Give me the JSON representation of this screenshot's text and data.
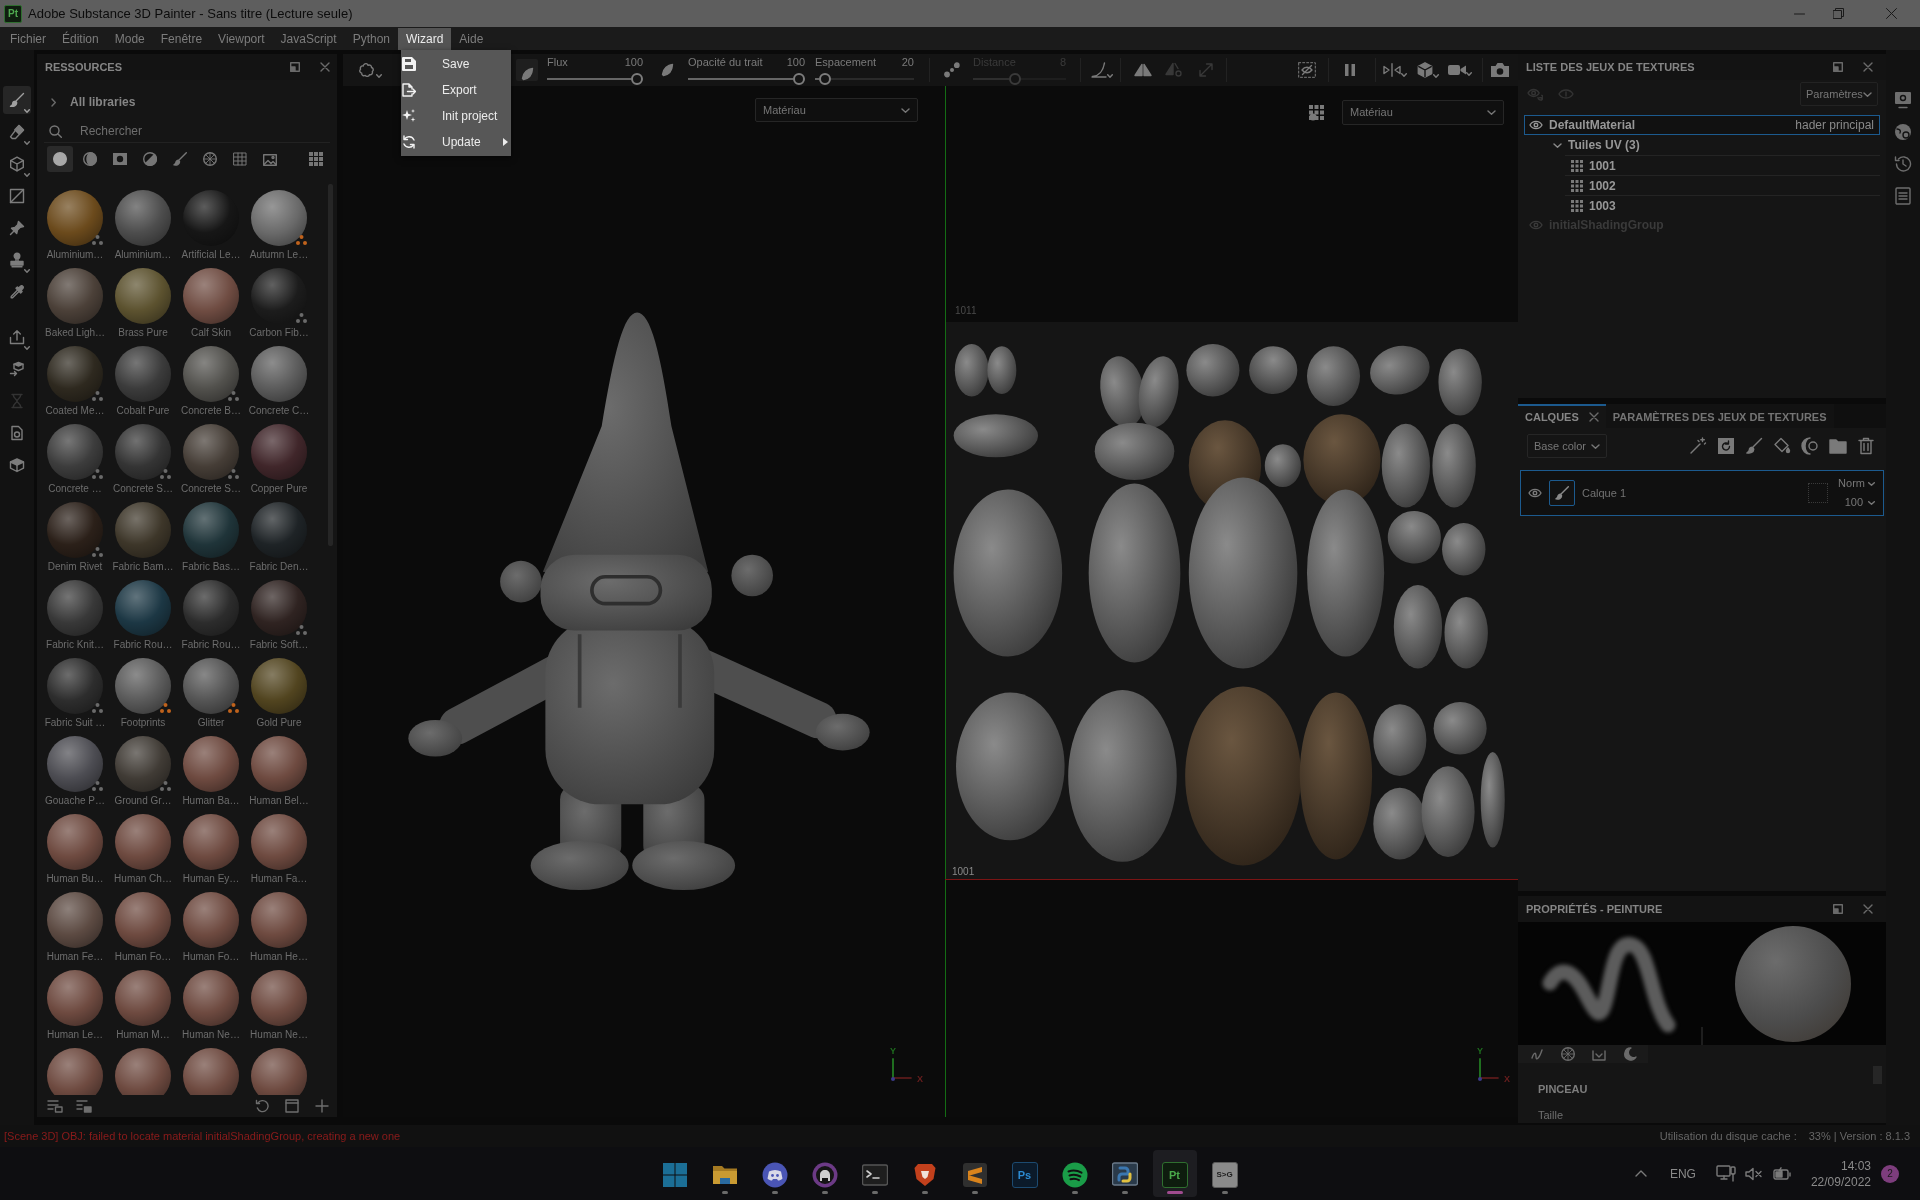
{
  "window": {
    "app_icon": "Pt",
    "title": "Adobe Substance 3D Painter - Sans titre (Lecture seule)"
  },
  "menu_bar": [
    {
      "label": "Fichier",
      "selected": false
    },
    {
      "label": "Édition",
      "selected": false
    },
    {
      "label": "Mode",
      "selected": false
    },
    {
      "label": "Fenêtre",
      "selected": false
    },
    {
      "label": "Viewport",
      "selected": false
    },
    {
      "label": "JavaScript",
      "selected": false
    },
    {
      "label": "Python",
      "selected": false
    },
    {
      "label": "Wizard",
      "selected": true
    },
    {
      "label": "Aide",
      "selected": false
    }
  ],
  "wizard_menu": [
    {
      "label": "Save",
      "submenu": false
    },
    {
      "label": "Export",
      "submenu": false
    },
    {
      "label": "Init project",
      "submenu": false
    },
    {
      "label": "Update",
      "submenu": true
    }
  ],
  "tools": [
    {
      "selected": true,
      "disabled": false,
      "caret": true
    },
    {
      "selected": false,
      "disabled": false,
      "caret": true
    },
    {
      "selected": false,
      "disabled": false,
      "caret": true
    },
    {
      "selected": false,
      "disabled": false,
      "caret": false
    },
    {
      "selected": false,
      "disabled": false,
      "caret": false
    },
    {
      "selected": false,
      "disabled": false,
      "caret": true
    },
    {
      "selected": false,
      "disabled": false,
      "caret": false
    },
    {
      "selected": false,
      "disabled": false,
      "caret": true
    },
    {
      "selected": false,
      "disabled": false,
      "caret": false
    },
    {
      "selected": false,
      "disabled": true,
      "caret": false
    },
    {
      "selected": false,
      "disabled": false,
      "caret": false
    },
    {
      "selected": false,
      "disabled": false,
      "caret": false
    }
  ],
  "resources": {
    "title": "RESSOURCES",
    "library": "All libraries",
    "library_expanded": false,
    "search_placeholder": "Rechercher",
    "filters": [
      {
        "selected": true
      },
      {
        "selected": false
      },
      {
        "selected": false
      },
      {
        "selected": false
      },
      {
        "selected": false
      },
      {
        "selected": false
      },
      {
        "selected": false
      },
      {
        "selected": false
      }
    ],
    "materials": [
      {
        "label": "Aluminium…",
        "color": "#6b4a1c",
        "badge": {
          "color": "#6a6a6a"
        }
      },
      {
        "label": "Aluminium…",
        "color": "#4d4d4d"
      },
      {
        "label": "Artificial Le…",
        "color": "#161616"
      },
      {
        "label": "Autumn Le…",
        "color": "#6a6a6a",
        "badge": {
          "color": "#c0621c"
        }
      },
      {
        "label": "Baked Ligh…",
        "color": "#4b4038"
      },
      {
        "label": "Brass Pure",
        "color": "#5c522f"
      },
      {
        "label": "Calf Skin",
        "color": "#6f4c42"
      },
      {
        "label": "Carbon Fib…",
        "color": "#1c1c1c",
        "badge": {
          "color": "#6a6a6a"
        }
      },
      {
        "label": "Coated Me…",
        "color": "#2e291f",
        "badge": {
          "color": "#6a6a6a"
        }
      },
      {
        "label": "Cobalt Pure",
        "color": "#3b3b3b"
      },
      {
        "label": "Concrete B…",
        "color": "#51504c",
        "badge": {
          "color": "#6a6a6a"
        }
      },
      {
        "label": "Concrete C…",
        "color": "#5b5b5b"
      },
      {
        "label": "Concrete …",
        "color": "#3c3c3c",
        "badge": {
          "color": "#6a6a6a"
        }
      },
      {
        "label": "Concrete S…",
        "color": "#343434",
        "badge": {
          "color": "#6a6a6a"
        }
      },
      {
        "label": "Concrete S…",
        "color": "#453d36",
        "badge": {
          "color": "#6a6a6a"
        }
      },
      {
        "label": "Copper Pure",
        "color": "#40262a"
      },
      {
        "label": "Denim Rivet",
        "color": "#2b2019",
        "badge": {
          "color": "#6a6a6a"
        }
      },
      {
        "label": "Fabric Bam…",
        "color": "#3d3629"
      },
      {
        "label": "Fabric Bas…",
        "color": "#1f3439"
      },
      {
        "label": "Fabric Den…",
        "color": "#1e2326"
      },
      {
        "label": "Fabric Knit…",
        "color": "#383838"
      },
      {
        "label": "Fabric Rou…",
        "color": "#1c3744"
      },
      {
        "label": "Fabric Rou…",
        "color": "#2c2c2c"
      },
      {
        "label": "Fabric Soft…",
        "color": "#2f2321",
        "badge": {
          "color": "#6a6a6a"
        }
      },
      {
        "label": "Fabric Suit …",
        "color": "#2d2d2d",
        "badge": {
          "color": "#6a6a6a"
        }
      },
      {
        "label": "Footprints",
        "color": "#5a5a5a",
        "badge": {
          "color": "#c0621c"
        }
      },
      {
        "label": "Glitter",
        "color": "#545454",
        "badge": {
          "color": "#c0621c"
        }
      },
      {
        "label": "Gold Pure",
        "color": "#51441f"
      },
      {
        "label": "Gouache P…",
        "color": "#4c4c52",
        "badge": {
          "color": "#6a6a6a"
        }
      },
      {
        "label": "Ground Gr…",
        "color": "#403b35",
        "badge": {
          "color": "#6a6a6a"
        }
      },
      {
        "label": "Human Ba…",
        "color": "#6e4a40"
      },
      {
        "label": "Human Bel…",
        "color": "#6e4a40"
      },
      {
        "label": "Human Bu…",
        "color": "#6e4a40"
      },
      {
        "label": "Human Ch…",
        "color": "#6e4a40"
      },
      {
        "label": "Human Ey…",
        "color": "#6e4a40"
      },
      {
        "label": "Human Fa…",
        "color": "#6e4a40"
      },
      {
        "label": "Human Fe…",
        "color": "#5c4a42"
      },
      {
        "label": "Human Fo…",
        "color": "#6e4a40"
      },
      {
        "label": "Human Fo…",
        "color": "#6e4a40"
      },
      {
        "label": "Human He…",
        "color": "#6e4a40"
      },
      {
        "label": "Human Le…",
        "color": "#6e4a40"
      },
      {
        "label": "Human M…",
        "color": "#6e4a40"
      },
      {
        "label": "Human Ne…",
        "color": "#6e4a40"
      },
      {
        "label": "Human Ne…",
        "color": "#6e4a40"
      },
      {
        "color": "#6e4a40"
      },
      {
        "color": "#6e4a40"
      },
      {
        "color": "#6e4a40"
      },
      {
        "color": "#6e4a40"
      }
    ]
  },
  "toolbar": {
    "buttons": [
      {
        "selected": false,
        "disabled": false,
        "caret": true
      },
      {
        "selected": true,
        "disabled": false,
        "caret": false
      },
      {
        "selected": false,
        "disabled": false,
        "caret": false
      },
      {
        "selected": false,
        "disabled": false,
        "caret": false
      },
      {
        "selected": false,
        "disabled": false,
        "caret": true
      },
      {
        "selected": false,
        "disabled": false,
        "caret": false
      },
      {
        "selected": false,
        "disabled": true,
        "caret": false
      },
      {
        "selected": false,
        "disabled": true,
        "caret": false
      },
      {
        "selected": false,
        "disabled": false,
        "caret": false
      },
      {
        "selected": false,
        "disabled": false,
        "caret": false
      },
      {
        "selected": false,
        "disabled": false,
        "caret": true
      },
      {
        "selected": false,
        "disabled": false,
        "caret": true
      },
      {
        "selected": false,
        "disabled": false,
        "caret": true
      },
      {
        "selected": false,
        "disabled": false,
        "caret": false
      }
    ],
    "sliders": [
      {
        "label": "Flux",
        "value": "100",
        "level": 1,
        "disabled": false
      },
      {
        "label": "Opacité du trait",
        "value": "100",
        "level": 1,
        "disabled": false
      },
      {
        "label": "Espacement",
        "value": "20",
        "level": 0.05,
        "disabled": false
      },
      {
        "label": "Distance",
        "value": "8",
        "level": 0.45,
        "disabled": true
      }
    ]
  },
  "viewport_3d": {
    "material_dropdown": "Matériau",
    "axis_labels": [
      "Y",
      "X"
    ]
  },
  "viewport_2d": {
    "material_dropdown": "Matériau",
    "tile_labels": [
      "1011",
      "1001"
    ],
    "axis_labels": [
      "Y",
      "X"
    ]
  },
  "texture_set_list": {
    "title": "LISTE DES JEUX DE TEXTURES",
    "settings": "Paramètres",
    "sets": [
      {
        "name": "DefaultMaterial",
        "shader": "hader principal",
        "selected": true,
        "disabled": false,
        "children": [
          {
            "name": "Tuiles UV (3)",
            "expanded": true,
            "children": [
              {
                "name": "1001"
              },
              {
                "name": "1002"
              },
              {
                "name": "1003"
              }
            ]
          }
        ]
      },
      {
        "name": "initialShadingGroup",
        "selected": false,
        "disabled": true
      }
    ]
  },
  "layers_panel": {
    "tabs": [
      {
        "label": "CALQUES",
        "selected": true,
        "closable": true
      },
      {
        "label": "PARAMÈTRES DES JEUX DE TEXTURES",
        "selected": false,
        "closable": false
      }
    ],
    "channel": "Base color",
    "layers": [
      {
        "name": "Calque 1",
        "blend": "Norm",
        "opacity": "100",
        "selected": true,
        "visible": true
      }
    ]
  },
  "properties_panel": {
    "title": "PROPRIÉTÉS - PEINTURE",
    "section": "PINCEAU",
    "fields": [
      {
        "label": "Taille"
      }
    ]
  },
  "status_bar": {
    "message": "[Scene 3D] OBJ: failed to locate material initialShadingGroup, creating a new one",
    "cache_label": "Utilisation du disque cache :",
    "cache_value": "33% | Version : 8.1.3"
  },
  "taskbar": {
    "apps": [
      {
        "running": false,
        "active": false
      },
      {
        "running": true,
        "active": false
      },
      {
        "running": true,
        "active": false
      },
      {
        "running": true,
        "active": false
      },
      {
        "running": true,
        "active": false
      },
      {
        "running": true,
        "active": false
      },
      {
        "running": true,
        "active": false
      },
      {
        "label": "Ps",
        "running": false,
        "active": false
      },
      {
        "running": true,
        "active": false
      },
      {
        "running": true,
        "active": false
      },
      {
        "label": "Pt",
        "running": true,
        "active": true
      },
      {
        "label": "S>G",
        "running": true,
        "active": false
      }
    ],
    "tray": {
      "language": "ENG",
      "time": "14:03",
      "date": "22/09/2022",
      "notifications": "2"
    }
  }
}
